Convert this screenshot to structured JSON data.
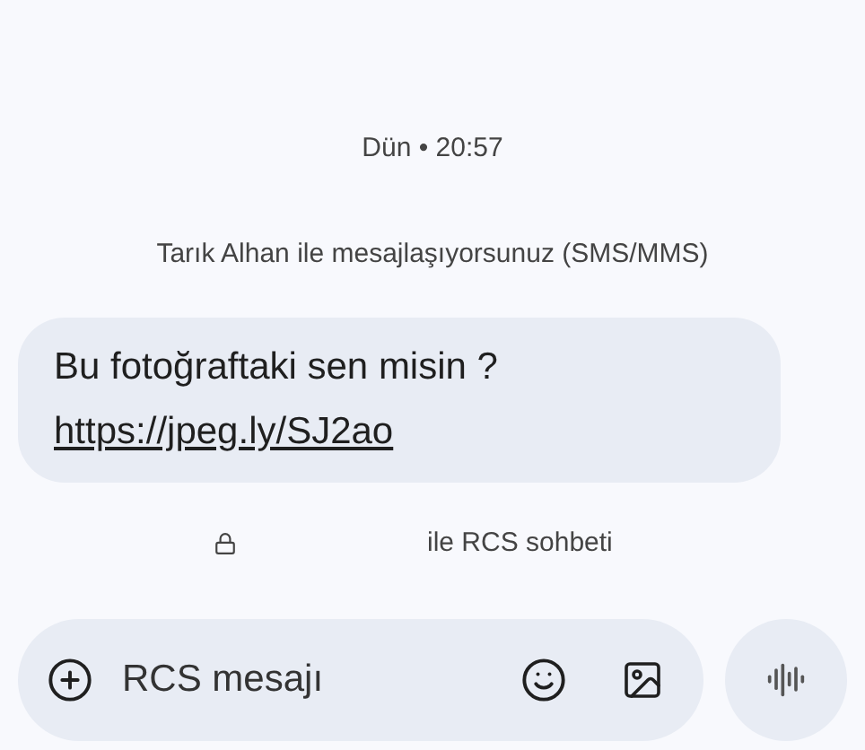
{
  "timestamp": "Dün • 20:57",
  "info": "Tarık Alhan ile mesajlaşıyorsunuz (SMS/MMS)",
  "message": {
    "text": "Bu fotoğraftaki sen misin ?",
    "link": "https://jpeg.ly/SJ2ao"
  },
  "encryption_note": "ile RCS sohbeti",
  "composer": {
    "placeholder": "RCS mesajı"
  }
}
